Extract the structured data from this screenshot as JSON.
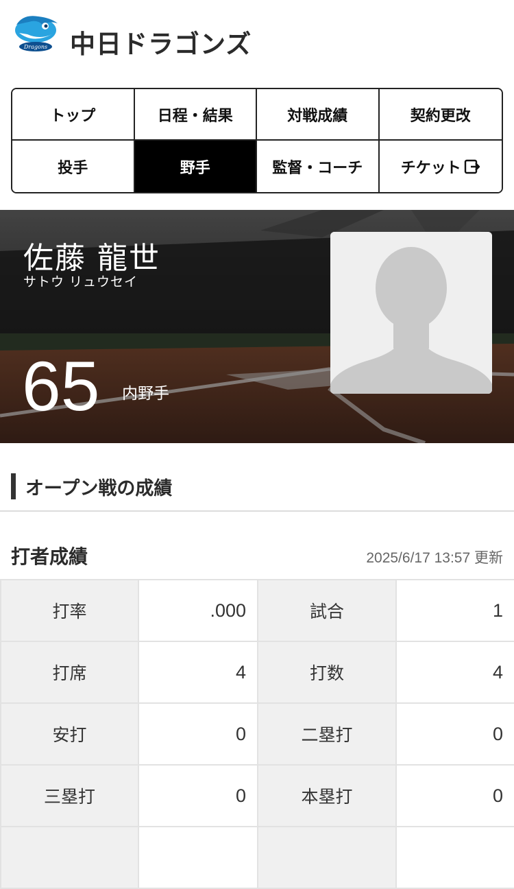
{
  "header": {
    "team_name": "中日ドラゴンズ",
    "logo_icon": "dragons-logo-icon"
  },
  "nav": {
    "items": [
      {
        "label": "トップ",
        "active": false
      },
      {
        "label": "日程・結果",
        "active": false
      },
      {
        "label": "対戦成績",
        "active": false
      },
      {
        "label": "契約更改",
        "active": false
      },
      {
        "label": "投手",
        "active": false
      },
      {
        "label": "野手",
        "active": true
      },
      {
        "label": "監督・コーチ",
        "active": false
      },
      {
        "label": "チケット",
        "active": false,
        "icon": "external-link-icon"
      }
    ]
  },
  "player": {
    "name": "佐藤 龍世",
    "kana": "サトウ リュウセイ",
    "number": "65",
    "position": "内野手",
    "photo_icon": "avatar-placeholder-icon"
  },
  "section": {
    "title": "オープン戦の成績"
  },
  "stats": {
    "heading": "打者成績",
    "updated": "2025/6/17 13:57 更新",
    "rows": [
      {
        "label1": "打率",
        "value1": ".000",
        "label2": "試合",
        "value2": "1"
      },
      {
        "label1": "打席",
        "value1": "4",
        "label2": "打数",
        "value2": "4"
      },
      {
        "label1": "安打",
        "value1": "0",
        "label2": "二塁打",
        "value2": "0"
      },
      {
        "label1": "三塁打",
        "value1": "0",
        "label2": "本塁打",
        "value2": "0"
      },
      {
        "label1": "",
        "value1": "",
        "label2": "",
        "value2": ""
      }
    ]
  },
  "colors": {
    "accent": "#000000",
    "label_bg": "#f0f0f0",
    "border": "#e2e2e2"
  }
}
